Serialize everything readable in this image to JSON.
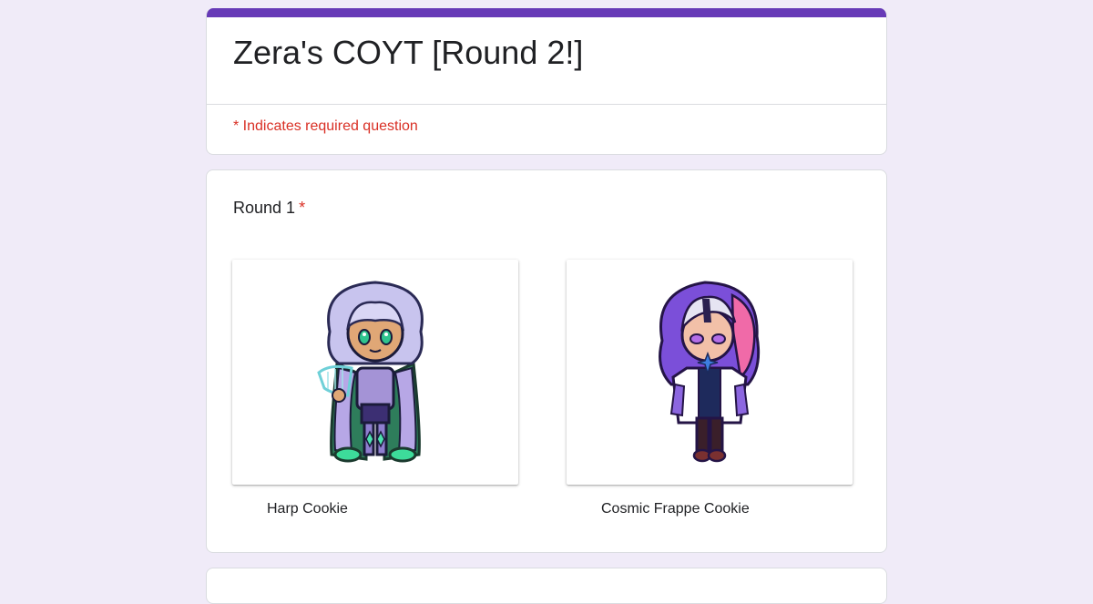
{
  "form": {
    "title": "Zera's COYT [Round 2!]",
    "required_note": "* Indicates required question",
    "accent_color": "#673ab7",
    "background_color": "#f0ebf8"
  },
  "question": {
    "title": "Round 1",
    "required_mark": "*",
    "options": [
      {
        "label": "Harp Cookie",
        "image": "harp-cookie-illustration"
      },
      {
        "label": "Cosmic Frappe Cookie",
        "image": "cosmic-frappe-cookie-illustration"
      }
    ]
  }
}
